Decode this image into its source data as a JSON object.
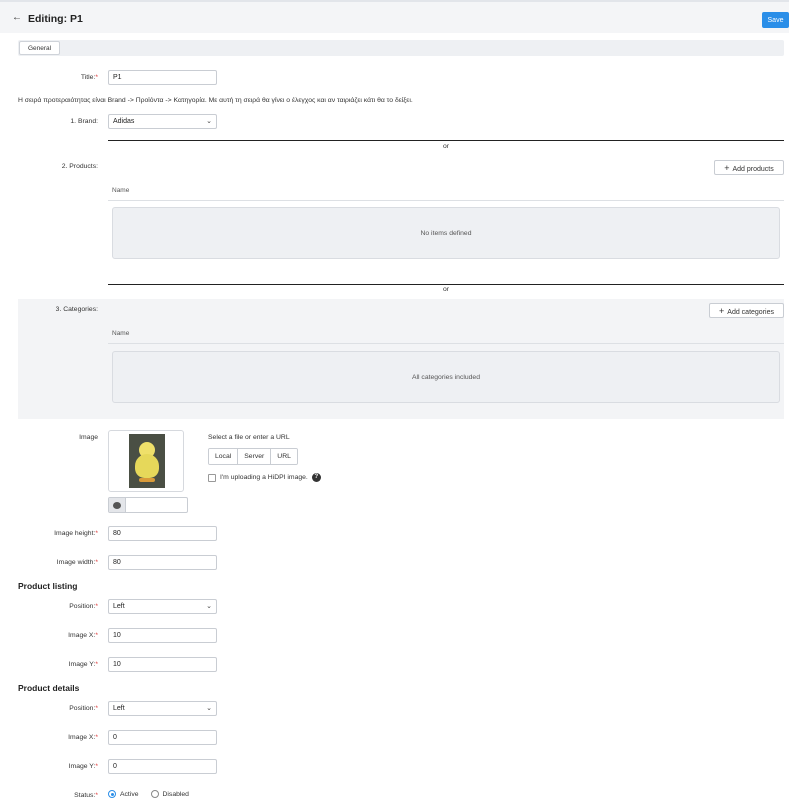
{
  "header": {
    "title": "Editing: P1",
    "save_label": "Save"
  },
  "tabs": [
    {
      "label": "General"
    }
  ],
  "fields": {
    "title": {
      "label": "Title:",
      "required_mark": "*",
      "value": "P1"
    },
    "info_text": "Η σειρά προτεραιότητας είναι Brand -> Προϊόντα -> Κατηγορία. Με αυτή τη σειρά θα γίνει ο έλεγχος και αν ταιριάζει κάτι θα το δείξει.",
    "brand": {
      "label": "1. Brand:",
      "value": "Adidas"
    },
    "or_label": "or",
    "products": {
      "label": "2. Products:",
      "add_label": "Add products",
      "column": "Name",
      "empty_text": "No items defined"
    },
    "categories": {
      "label": "3. Categories:",
      "add_label": "Add categories",
      "column": "Name",
      "empty_text": "All categories included"
    },
    "image": {
      "label": "Image",
      "source_prompt": "Select a file or enter a URL",
      "sources": [
        "Local",
        "Server",
        "URL"
      ],
      "hidpi_label": "I'm uploading a HiDPI image.",
      "help_glyph": "?",
      "alt_value": ""
    },
    "image_height": {
      "label": "Image height:",
      "required_mark": "*",
      "value": "80"
    },
    "image_width": {
      "label": "Image width:",
      "required_mark": "*",
      "value": "80"
    }
  },
  "product_listing": {
    "title": "Product listing",
    "position": {
      "label": "Position:",
      "required_mark": "*",
      "value": "Left"
    },
    "image_x": {
      "label": "Image X:",
      "required_mark": "*",
      "value": "10"
    },
    "image_y": {
      "label": "Image Y:",
      "required_mark": "*",
      "value": "10"
    }
  },
  "product_details": {
    "title": "Product details",
    "position": {
      "label": "Position:",
      "required_mark": "*",
      "value": "Left"
    },
    "image_x": {
      "label": "Image X:",
      "required_mark": "*",
      "value": "0"
    },
    "image_y": {
      "label": "Image Y:",
      "required_mark": "*",
      "value": "0"
    }
  },
  "status": {
    "label": "Status:",
    "required_mark": "*",
    "options": [
      {
        "label": "Active",
        "selected": true
      },
      {
        "label": "Disabled",
        "selected": false
      }
    ]
  },
  "colors": {
    "accent": "#2a8ee8",
    "required": "#dd3333"
  },
  "icons": {
    "back": "arrow-left-icon",
    "chevron": "chevron-down-icon",
    "plus": "plus-icon",
    "comment": "comment-icon",
    "help": "help-icon"
  }
}
